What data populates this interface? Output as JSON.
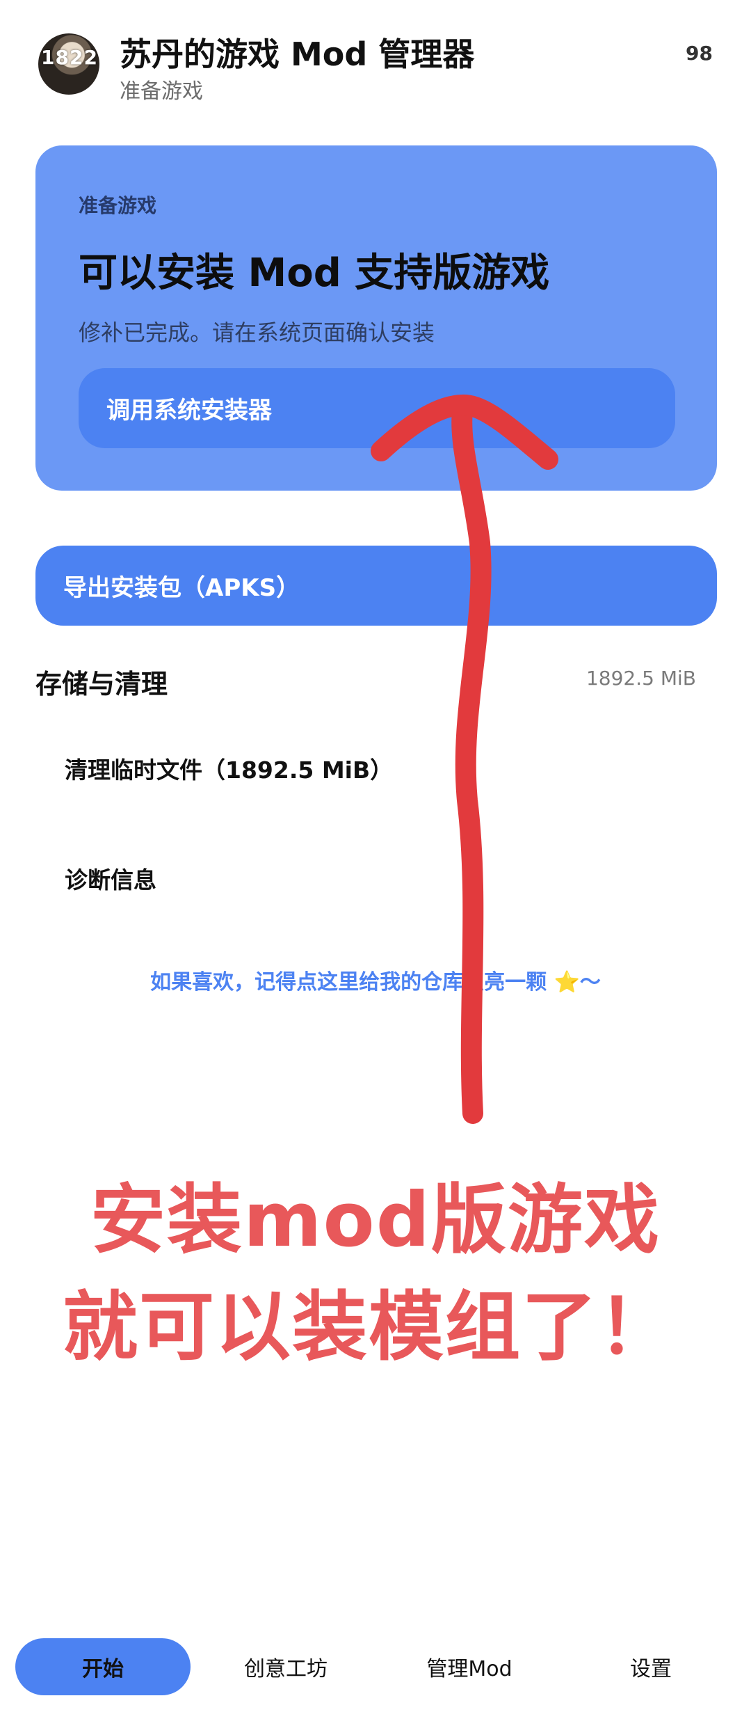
{
  "header": {
    "avatar_text": "1822",
    "title": "苏丹的游戏 Mod 管理器",
    "subtitle": "准备游戏",
    "counter": "98"
  },
  "card": {
    "kicker": "准备游戏",
    "title": "可以安装 Mod 支持版游戏",
    "description": "修补已完成。请在系统页面确认安装",
    "button_label": "调用系统安装器"
  },
  "export_button": {
    "label": "导出安装包（APKS）"
  },
  "storage": {
    "title": "存储与清理",
    "size": "1892.5 MiB",
    "items": [
      {
        "label": "清理临时文件（1892.5 MiB）"
      },
      {
        "label": "诊断信息"
      }
    ]
  },
  "star_link": "如果喜欢，记得点这里给我的仓库点亮一颗 ⭐～",
  "annotation": {
    "line1": "安装mod版游戏",
    "line2": "就可以装模组了！",
    "color": "#e8585a"
  },
  "bottom_nav": {
    "items": [
      {
        "label": "开始",
        "active": true
      },
      {
        "label": "创意工坊",
        "active": false
      },
      {
        "label": "管理Mod",
        "active": false
      },
      {
        "label": "设置",
        "active": false
      }
    ]
  },
  "colors": {
    "accent": "#4c82f2",
    "card_bg": "#6b98f5",
    "arrow": "#e23a3d"
  }
}
